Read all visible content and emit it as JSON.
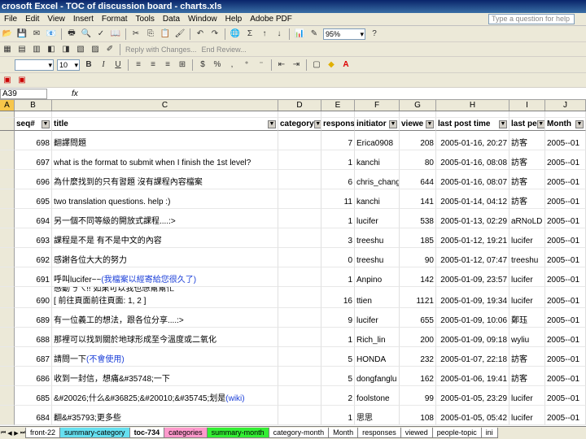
{
  "window": {
    "title": "crosoft Excel - TOC of discussion board - charts.xls"
  },
  "menu": [
    "File",
    "Edit",
    "View",
    "Insert",
    "Format",
    "Tools",
    "Data",
    "Window",
    "Help",
    "Adobe PDF"
  ],
  "help_placeholder": "Type a question for help",
  "toolbar": {
    "zoom": "95%",
    "font_size": "10",
    "reply_label": "Reply with Changes...",
    "end_review_label": "End Review..."
  },
  "formula_bar": {
    "name_box": "A39",
    "fx_label": "fx"
  },
  "columns": [
    "A",
    "B",
    "C",
    "D",
    "E",
    "F",
    "G",
    "H",
    "I",
    "J"
  ],
  "headers": {
    "seq": "seq#",
    "title": "title",
    "category": "category",
    "responses": "respons",
    "initiator": "initiator",
    "views": "viewe",
    "last_post": "last post time",
    "last_poster": "last pe",
    "month": "Month"
  },
  "rows": [
    {
      "seq": "698",
      "title": "翻譯問題",
      "link": "",
      "resp": "7",
      "init": "Erica0908",
      "views": "208",
      "last": "2005-01-16, 20:27",
      "by": "訪客",
      "month": "2005--01"
    },
    {
      "seq": "697",
      "title": "what is the format to submit when I finish the 1st level?",
      "link": "",
      "resp": "1",
      "init": "kanchi",
      "views": "80",
      "last": "2005-01-16, 08:08",
      "by": "訪客",
      "month": "2005--01"
    },
    {
      "seq": "696",
      "title": "為什麼找到的只有習題 沒有課程內容檔案",
      "link": "",
      "resp": "6",
      "init": "chris_chang",
      "views": "644",
      "last": "2005-01-16, 08:07",
      "by": "訪客",
      "month": "2005--01"
    },
    {
      "seq": "695",
      "title": "two translation questions. help :)",
      "link": "",
      "resp": "11",
      "init": "kanchi",
      "views": "141",
      "last": "2005-01-14, 04:12",
      "by": "訪客",
      "month": "2005--01"
    },
    {
      "seq": "694",
      "title": "另一個不同等級的開放式課程....:>",
      "link": "",
      "resp": "1",
      "init": "lucifer",
      "views": "538",
      "last": "2005-01-13, 02:29",
      "by": "aRNoLD",
      "month": "2005--01"
    },
    {
      "seq": "693",
      "title": "課程是不是 有不是中文的內容",
      "link": "",
      "resp": "3",
      "init": "treeshu",
      "views": "185",
      "last": "2005-01-12, 19:21",
      "by": "lucifer",
      "month": "2005--01"
    },
    {
      "seq": "692",
      "title": "感謝各位大大的努力",
      "link": "",
      "resp": "0",
      "init": "treeshu",
      "views": "90",
      "last": "2005-01-12, 07:47",
      "by": "treeshu",
      "month": "2005--01"
    },
    {
      "seq": "691",
      "title": "呼叫lucifer~~ ",
      "link": "(我檔案以經寄給您很久了)",
      "resp": "1",
      "init": "Anpino",
      "views": "142",
      "last": "2005-01-09, 23:57",
      "by": "lucifer",
      "month": "2005--01"
    },
    {
      "seq": "690",
      "title": "感動ㄋㄟ!! 如果可以我也想幫幫忙",
      "title2": "[ 前往頁面前往頁面: 1, 2 ]",
      "link": "",
      "resp": "16",
      "init": "ttien",
      "views": "1121",
      "last": "2005-01-09, 19:34",
      "by": "lucifer",
      "month": "2005--01"
    },
    {
      "seq": "689",
      "title": "有一位義工的想法，跟各位分享....:>",
      "link": "",
      "resp": "9",
      "init": "lucifer",
      "views": "655",
      "last": "2005-01-09, 10:06",
      "by": "鄭珏",
      "month": "2005--01"
    },
    {
      "seq": "688",
      "title": "那裡可以找到關於地球形成至今溫度或二氧化",
      "link": "",
      "resp": "1",
      "init": "Rich_lin",
      "views": "200",
      "last": "2005-01-09, 09:18",
      "by": "wyliu",
      "month": "2005--01"
    },
    {
      "seq": "687",
      "title": "請問一下 ",
      "link": "(不會使用)",
      "resp": "5",
      "init": "HONDA",
      "views": "232",
      "last": "2005-01-07, 22:18",
      "by": "訪客",
      "month": "2005--01"
    },
    {
      "seq": "686",
      "title": "收到一封信，想痛&#35748;一下",
      "link": "",
      "resp": "5",
      "init": "dongfanglu",
      "views": "162",
      "last": "2005-01-06, 19:41",
      "by": "訪客",
      "month": "2005--01"
    },
    {
      "seq": "685",
      "title": "&#20026;什么&#36825;&#20010;&#35745;划是 ",
      "link": "(wiki)",
      "resp": "2",
      "init": "foolstone",
      "views": "99",
      "last": "2005-01-05, 23:29",
      "by": "lucifer",
      "month": "2005--01"
    },
    {
      "seq": "684",
      "title": "翻&#35793;更多些",
      "link": "",
      "resp": "1",
      "init": "思思",
      "views": "108",
      "last": "2005-01-05, 05:42",
      "by": "lucifer",
      "month": "2005--01"
    }
  ],
  "sheet_tabs": [
    "front-22",
    "summary-category",
    "toc-734",
    "categories",
    "summary-month",
    "category-month",
    "Month",
    "responses",
    "viewed",
    "people-topic",
    "ini"
  ],
  "tab_colors": [
    "#ffffff",
    "#66e0f0",
    "#ffffff",
    "#ff99cc",
    "#33ee33",
    "#ffffff",
    "#ffffff",
    "#ffffff",
    "#ffffff",
    "#ffffff",
    "#ffffff"
  ],
  "active_tab": "toc-734"
}
